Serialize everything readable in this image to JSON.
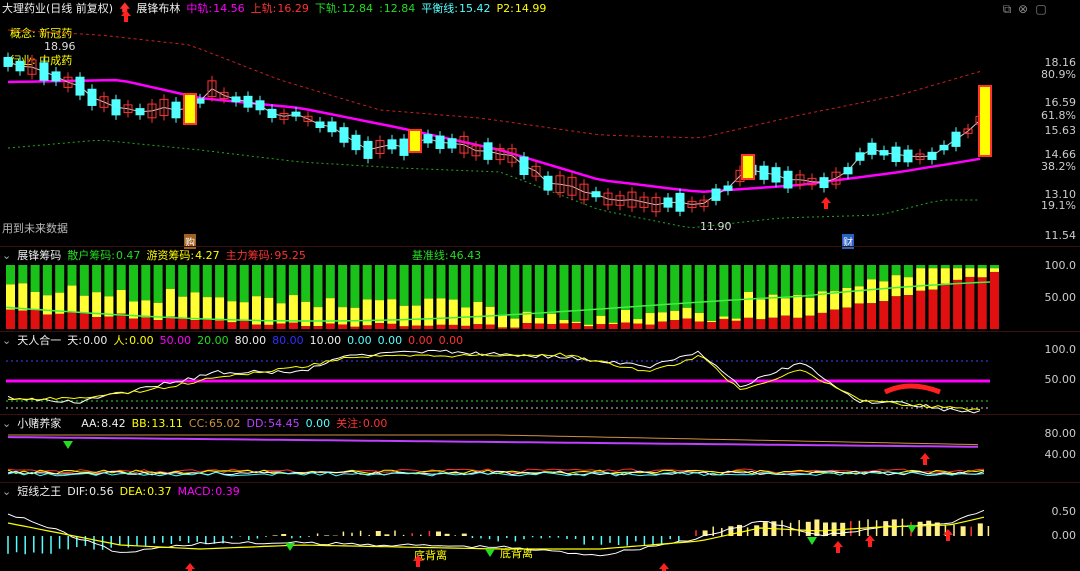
{
  "main": {
    "stock": "大理药业(日线 前复权)",
    "indicator": "展锋布林",
    "labels": [
      "中轨:",
      "上轨:",
      "下轨:",
      ":",
      "平衡线:",
      "P2:"
    ],
    "values": [
      "14.56",
      "16.29",
      "12.84",
      "12.84",
      "15.42",
      "14.99"
    ],
    "concept_label": "概念:",
    "concept_value": "新冠药",
    "industry_label": "行业:",
    "industry_value": "中成药",
    "top_value": "18.96",
    "low_value": "11.90",
    "future_data": "用到未来数据",
    "tag_buy": "购",
    "tag_fin": "财",
    "axis_price": [
      "18.16",
      "80.9%",
      "16.59",
      "61.8%",
      "15.63",
      "14.66",
      "38.2%",
      "13.10",
      "19.1%",
      "11.54"
    ],
    "count_marks": [
      "2",
      "3",
      "1",
      "7",
      "8",
      "1",
      "3",
      "4",
      "5",
      "6",
      "7",
      "8",
      "9",
      "1",
      "2",
      "3",
      "4",
      "5"
    ]
  },
  "chip": {
    "name": "展锋筹码",
    "labels": [
      "散户筹码:",
      "游资筹码:",
      "主力筹码:",
      "基准线:"
    ],
    "values": [
      "0.47",
      "4.27",
      "95.25",
      "46.43"
    ],
    "axis": [
      "100.0",
      "50.00"
    ]
  },
  "tianren": {
    "name": "天人合一",
    "labels": [
      "天:",
      "人:"
    ],
    "values": [
      "0.00",
      "0.00",
      "50.00",
      "20.00",
      "80.00",
      "80.00",
      "10.00",
      "0.00",
      "0.00",
      "0.00",
      "0.00"
    ],
    "axis": [
      "100.0",
      "50.00"
    ]
  },
  "xiaodu": {
    "name": "小赌养家",
    "labels": [
      "AA:",
      "BB:",
      "CC:",
      "DD:",
      "关注:"
    ],
    "values": [
      "8.42",
      "13.11",
      "65.02",
      "54.45",
      "0.00",
      "0.00"
    ],
    "axis": [
      "80.00",
      "40.00"
    ]
  },
  "macd": {
    "name": "短线之王",
    "labels": [
      "DIF:",
      "DEA:",
      "MACD:"
    ],
    "values": [
      "0.56",
      "0.37",
      "0.39"
    ],
    "axis": [
      "0.50",
      "0.00"
    ],
    "signals": [
      "底背离",
      "底背离"
    ]
  },
  "colors": {
    "up": "#ff3232",
    "down": "#54ffff",
    "mid": "#ff00ff",
    "band": "#c62020",
    "lower": "#22aa22",
    "ma": "#ffffff",
    "yellow": "#ffff00",
    "green": "#00cc00"
  }
}
